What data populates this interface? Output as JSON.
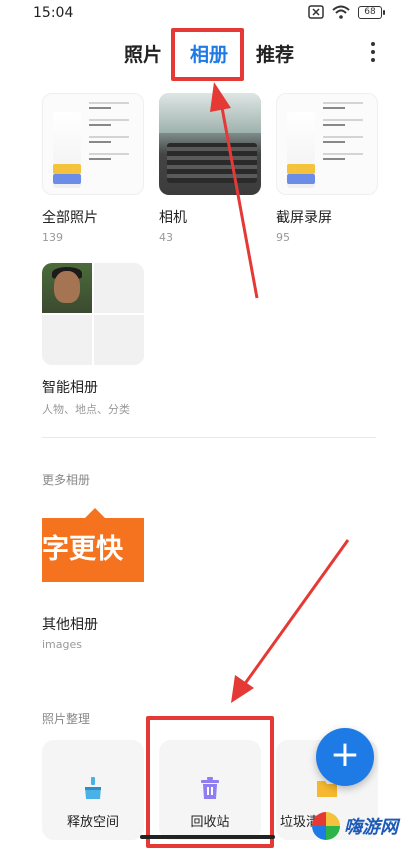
{
  "status_bar": {
    "time": "15:04",
    "battery": "68"
  },
  "tabs": [
    {
      "label": "照片",
      "active": false
    },
    {
      "label": "相册",
      "active": true
    },
    {
      "label": "推荐",
      "active": false
    }
  ],
  "albums": [
    {
      "name": "全部照片",
      "count": "139"
    },
    {
      "name": "相机",
      "count": "43"
    },
    {
      "name": "截屏录屏",
      "count": "95"
    },
    {
      "name": "智能相册",
      "count": "人物、地点、分类"
    }
  ],
  "more_section": {
    "title": "更多相册",
    "album": {
      "name": "其他相册",
      "count": "images",
      "thumb_text": "字更快"
    }
  },
  "organize_section": {
    "title": "照片整理",
    "tools": [
      {
        "label": "释放空间",
        "icon": "broom-icon"
      },
      {
        "label": "回收站",
        "icon": "trash-icon"
      },
      {
        "label": "垃圾清理",
        "icon": "folder-icon"
      }
    ]
  },
  "fab_label": "+",
  "watermark": "嗨游网",
  "colors": {
    "accent": "#1e7be6",
    "highlight": "#e53935",
    "orange": "#f5731f"
  }
}
